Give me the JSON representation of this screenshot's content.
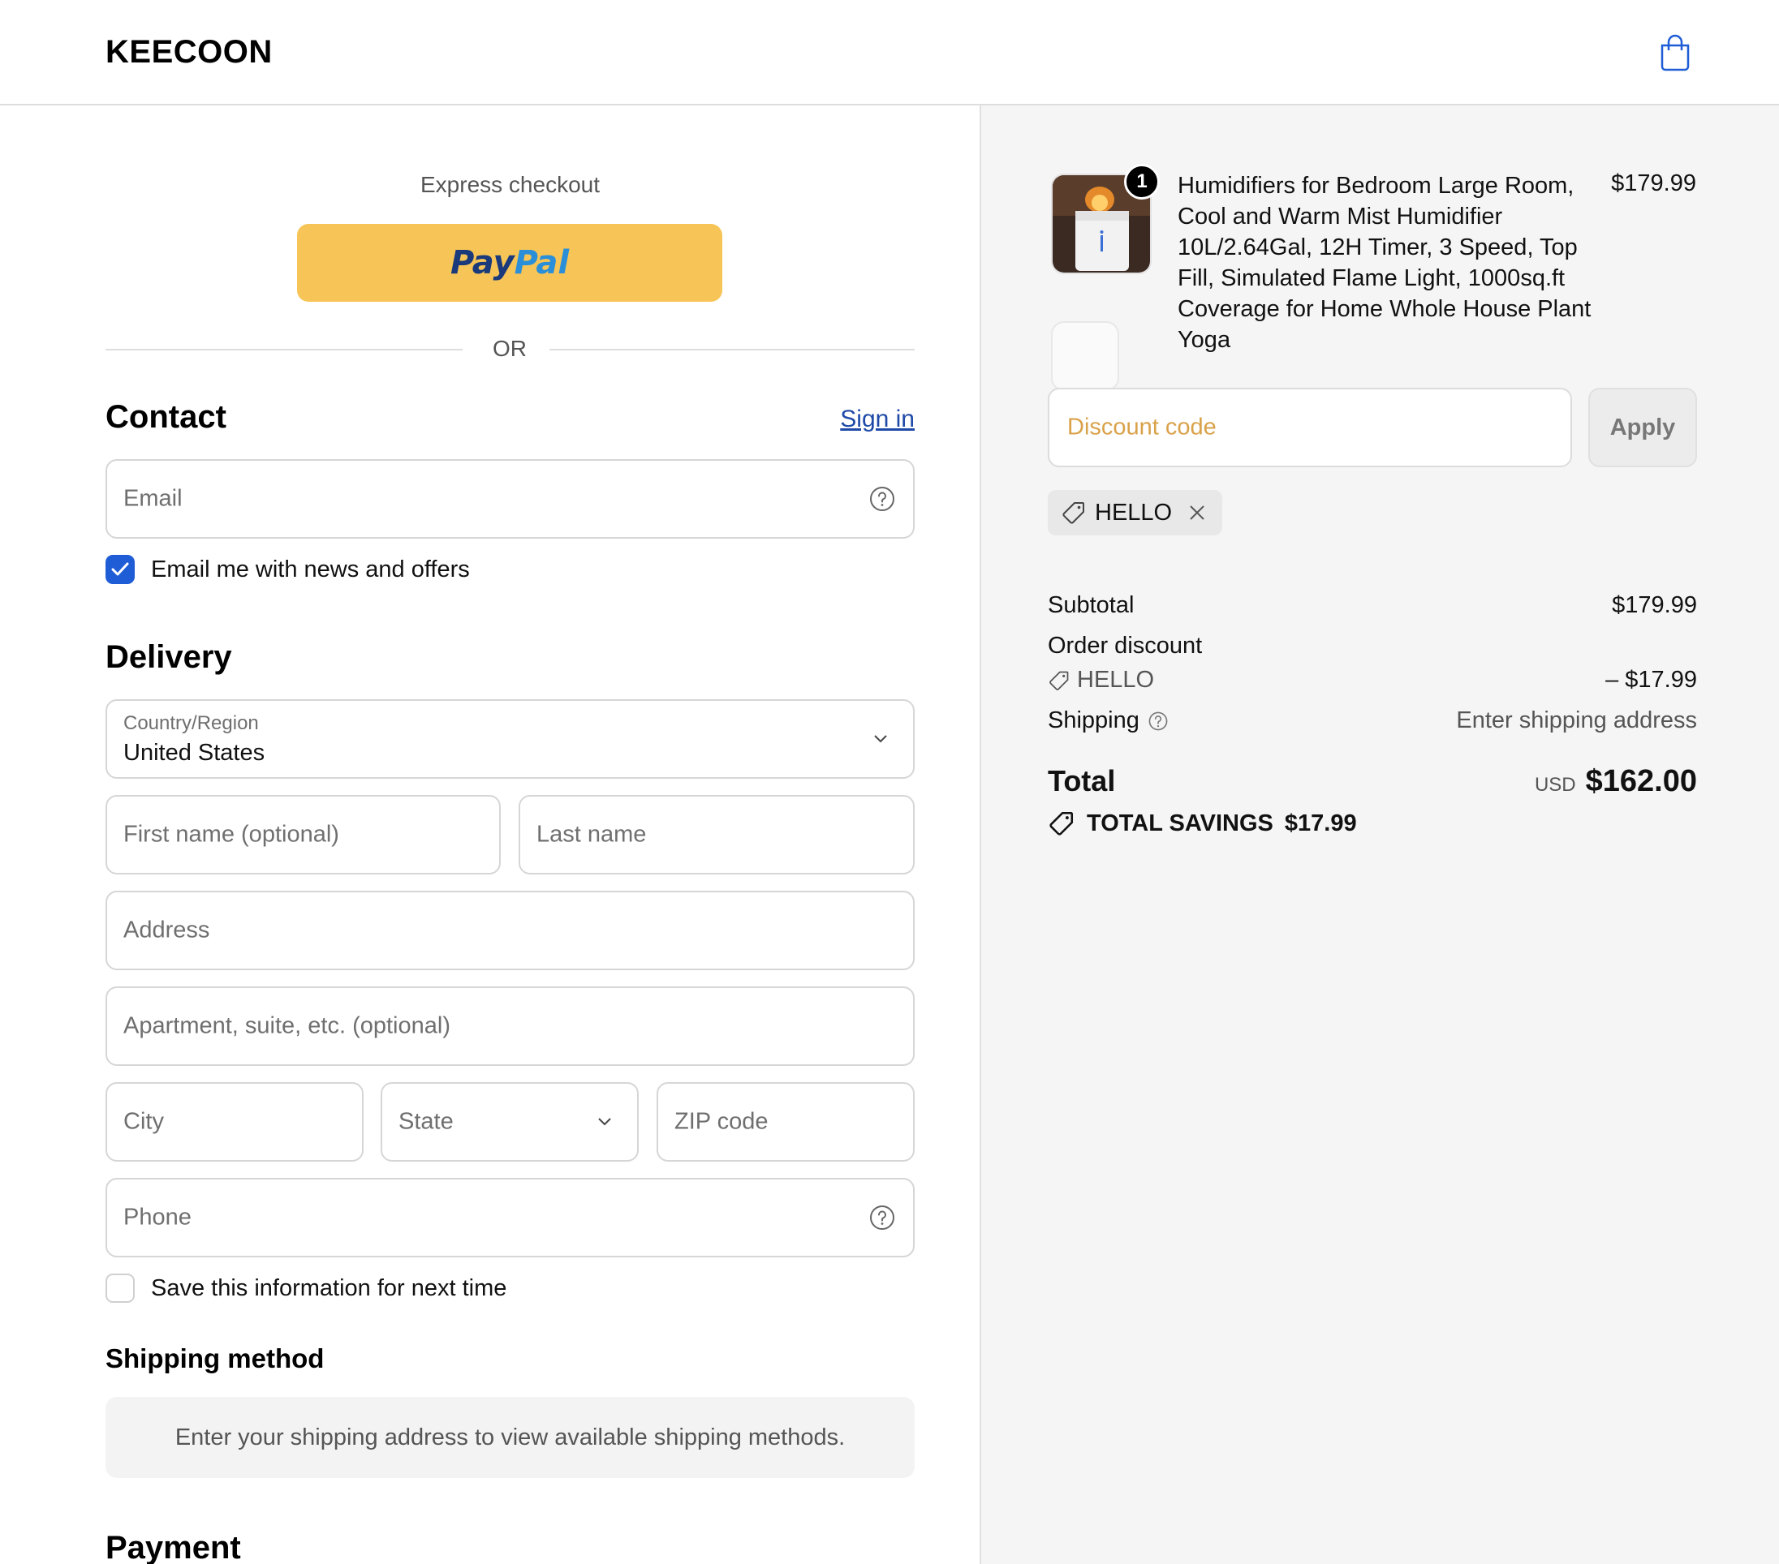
{
  "header": {
    "brand": "KEECOON"
  },
  "express": {
    "label": "Express checkout",
    "paypal_pay": "Pay",
    "paypal_pal": "Pal",
    "or": "OR"
  },
  "contact": {
    "title": "Contact",
    "signin": "Sign in",
    "email_placeholder": "Email",
    "news_label": "Email me with news and offers",
    "news_checked": true
  },
  "delivery": {
    "title": "Delivery",
    "country_label": "Country/Region",
    "country_value": "United States",
    "first_name": "First name (optional)",
    "last_name": "Last name",
    "address": "Address",
    "apartment": "Apartment, suite, etc. (optional)",
    "city": "City",
    "state": "State",
    "zip": "ZIP code",
    "phone": "Phone",
    "save_label": "Save this information for next time",
    "save_checked": false
  },
  "shipping_method": {
    "title": "Shipping method",
    "note": "Enter your shipping address to view available shipping methods."
  },
  "payment": {
    "title": "Payment"
  },
  "order": {
    "product": {
      "quantity": "1",
      "title": "Humidifiers for Bedroom Large Room, Cool and Warm Mist Humidifier 10L/2.64Gal, 12H Timer, 3 Speed, Top Fill, Simulated Flame Light, 1000sq.ft Coverage for Home Whole House Plant Yoga",
      "price": "$179.99"
    },
    "discount_placeholder": "Discount code",
    "apply": "Apply",
    "applied_code": "HELLO",
    "subtotal_label": "Subtotal",
    "subtotal_value": "$179.99",
    "order_discount_label": "Order discount",
    "discount_code": "HELLO",
    "discount_value": "– $17.99",
    "shipping_label": "Shipping",
    "shipping_value": "Enter shipping address",
    "total_label": "Total",
    "currency": "USD",
    "total_value": "$162.00",
    "savings_label": "TOTAL SAVINGS",
    "savings_value": "$17.99"
  },
  "colors": {
    "accent": "#1f5dd6",
    "paypal": "#f7c557",
    "link": "#1f4aa8",
    "discount_placeholder": "#d9a24a"
  }
}
